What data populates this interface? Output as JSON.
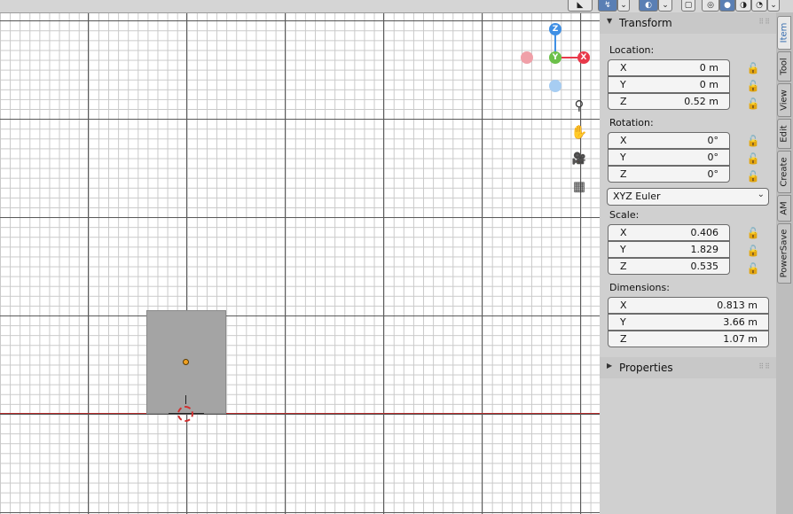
{
  "header": {
    "icons": [
      "camera-view-icon",
      "cursor-tool-icon",
      "overlay-icon",
      "xray-icon",
      "wireframe-shading-icon",
      "solid-shading-icon",
      "material-shading-icon",
      "rendered-shading-icon"
    ],
    "dropdown_glyph": "⌄"
  },
  "gizmo": {
    "z": "Z",
    "y": "Y",
    "x": "X"
  },
  "nav_icons": {
    "zoom": "⚲",
    "pan": "✋",
    "camera": "🎥",
    "grid": "▦"
  },
  "panel": {
    "transform": {
      "title": "Transform",
      "collapse_glyph": "▼",
      "location": {
        "label": "Location:",
        "rows": [
          {
            "axis": "X",
            "value": "0 m"
          },
          {
            "axis": "Y",
            "value": "0 m"
          },
          {
            "axis": "Z",
            "value": "0.52 m"
          }
        ]
      },
      "rotation": {
        "label": "Rotation:",
        "rows": [
          {
            "axis": "X",
            "value": "0°"
          },
          {
            "axis": "Y",
            "value": "0°"
          },
          {
            "axis": "Z",
            "value": "0°"
          }
        ],
        "mode": "XYZ Euler"
      },
      "scale": {
        "label": "Scale:",
        "rows": [
          {
            "axis": "X",
            "value": "0.406"
          },
          {
            "axis": "Y",
            "value": "1.829"
          },
          {
            "axis": "Z",
            "value": "0.535"
          }
        ]
      },
      "dimensions": {
        "label": "Dimensions:",
        "rows": [
          {
            "axis": "X",
            "value": "0.813 m"
          },
          {
            "axis": "Y",
            "value": "3.66 m"
          },
          {
            "axis": "Z",
            "value": "1.07 m"
          }
        ]
      }
    },
    "properties": {
      "title": "Properties",
      "expand_glyph": "▶"
    }
  },
  "tabs": [
    {
      "label": "Item",
      "active": true
    },
    {
      "label": "Tool",
      "active": false
    },
    {
      "label": "View",
      "active": false
    },
    {
      "label": "Edit",
      "active": false
    },
    {
      "label": "Create",
      "active": false
    },
    {
      "label": "AM",
      "active": false
    },
    {
      "label": "PowerSave",
      "active": false
    }
  ],
  "colors": {
    "x_axis": "#e8394a",
    "y_axis": "#6cc04a",
    "z_axis": "#3f8fe4",
    "active_tab_text": "#3a6fb0",
    "origin": "#f0a020"
  }
}
